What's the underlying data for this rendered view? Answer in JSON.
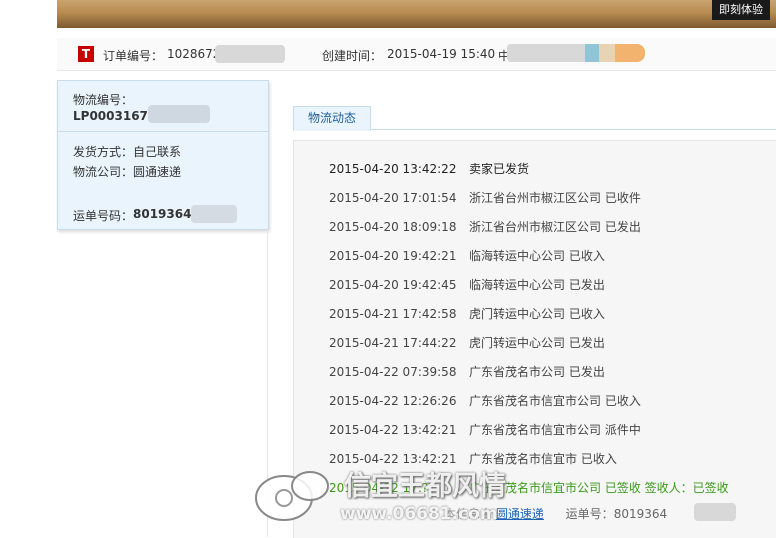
{
  "header": {
    "try_button": "即刻体验"
  },
  "order": {
    "number_label": "订单编号：",
    "number_value": "1028672",
    "created_label": "创建时间：",
    "created_value": "2015-04-19 15:40",
    "extra_char": "中"
  },
  "logistics": {
    "id_label": "物流编号：",
    "id_value": "LP0003167",
    "ship_method_label": "发货方式：",
    "ship_method_value": "自己联系",
    "company_label": "物流公司：",
    "company_value": "圆通速递",
    "waybill_label": "运单号码：",
    "waybill_value": "8019364"
  },
  "tab": {
    "label": "物流动态"
  },
  "tracking": [
    {
      "time": "2015-04-20 13:42:22",
      "event": "卖家已发货"
    },
    {
      "time": "2015-04-20 17:01:54",
      "event": "浙江省台州市椒江区公司 已收件"
    },
    {
      "time": "2015-04-20 18:09:18",
      "event": "浙江省台州市椒江区公司 已发出"
    },
    {
      "time": "2015-04-20 19:42:21",
      "event": "临海转运中心公司 已收入"
    },
    {
      "time": "2015-04-20 19:42:45",
      "event": "临海转运中心公司 已发出"
    },
    {
      "time": "2015-04-21 17:42:58",
      "event": "虎门转运中心公司 已收入"
    },
    {
      "time": "2015-04-21 17:44:22",
      "event": "虎门转运中心公司 已发出"
    },
    {
      "time": "2015-04-22 07:39:58",
      "event": "广东省茂名市公司 已发出"
    },
    {
      "time": "2015-04-22 12:26:26",
      "event": "广东省茂名市信宜市公司 已收入"
    },
    {
      "time": "2015-04-22 13:42:21",
      "event": "广东省茂名市信宜市公司 派件中"
    },
    {
      "time": "2015-04-22 13:42:21",
      "event": "广东省茂名市信宜市 已收入"
    },
    {
      "time": "2015-04-22 17:??:??",
      "event": "广东省茂名市信宜市公司 已签收 签收人：已签收"
    }
  ],
  "footer": {
    "carrier_prefix": "本信息由",
    "carrier_link": "圆通速递",
    "waybill_label": "运单号：",
    "waybill_value": "8019364"
  },
  "watermark": {
    "text": "信宜王都风情",
    "url": "www.06681.com"
  },
  "colors": {
    "signed": "#3a9a1a",
    "link": "#1a63b5",
    "tab_text": "#1f5f9a",
    "logo_red": "#c40000"
  }
}
